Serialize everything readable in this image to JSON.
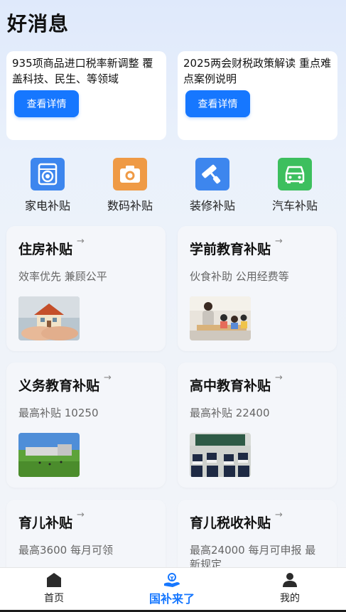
{
  "title": "好消息",
  "news": [
    {
      "text": "935项商品进口税率新调整 覆盖科技、民生、等领域",
      "button": "查看详情"
    },
    {
      "text": "2025两会财税政策解读 重点难点案例说明",
      "button": "查看详情"
    }
  ],
  "categories": [
    {
      "label": "家电补贴",
      "icon": "washing-machine-icon",
      "color": "#3b82f6"
    },
    {
      "label": "数码补贴",
      "icon": "camera-icon",
      "color": "#f59e42"
    },
    {
      "label": "装修补贴",
      "icon": "paint-roller-icon",
      "color": "#3b82f6"
    },
    {
      "label": "汽车补贴",
      "icon": "car-icon",
      "color": "#22c55e"
    }
  ],
  "cards": [
    {
      "title": "住房补贴",
      "subtitle": "效率优先 兼顾公平",
      "image": "house-in-hands-photo"
    },
    {
      "title": "学前教育补贴",
      "subtitle": "伙食补助 公用经费等",
      "image": "preschool-class-photo"
    },
    {
      "title": "义务教育补贴",
      "subtitle": "最高补贴 10250",
      "image": "school-campus-photo"
    },
    {
      "title": "高中教育补贴",
      "subtitle": "最高补贴 22400",
      "image": "classroom-exam-photo"
    },
    {
      "title": "育儿补贴",
      "subtitle": "最高3600 每月可领",
      "image": ""
    },
    {
      "title": "育儿税收补贴",
      "subtitle": "最高24000 每月可申报 最新规定",
      "image": ""
    }
  ],
  "card_arrow": "→",
  "tabs": [
    {
      "label": "首页",
      "icon": "home-icon"
    },
    {
      "label": "国补来了",
      "icon": "subsidy-icon",
      "active": true
    },
    {
      "label": "我的",
      "icon": "user-icon"
    }
  ],
  "colors": {
    "accent": "#1677ff"
  }
}
